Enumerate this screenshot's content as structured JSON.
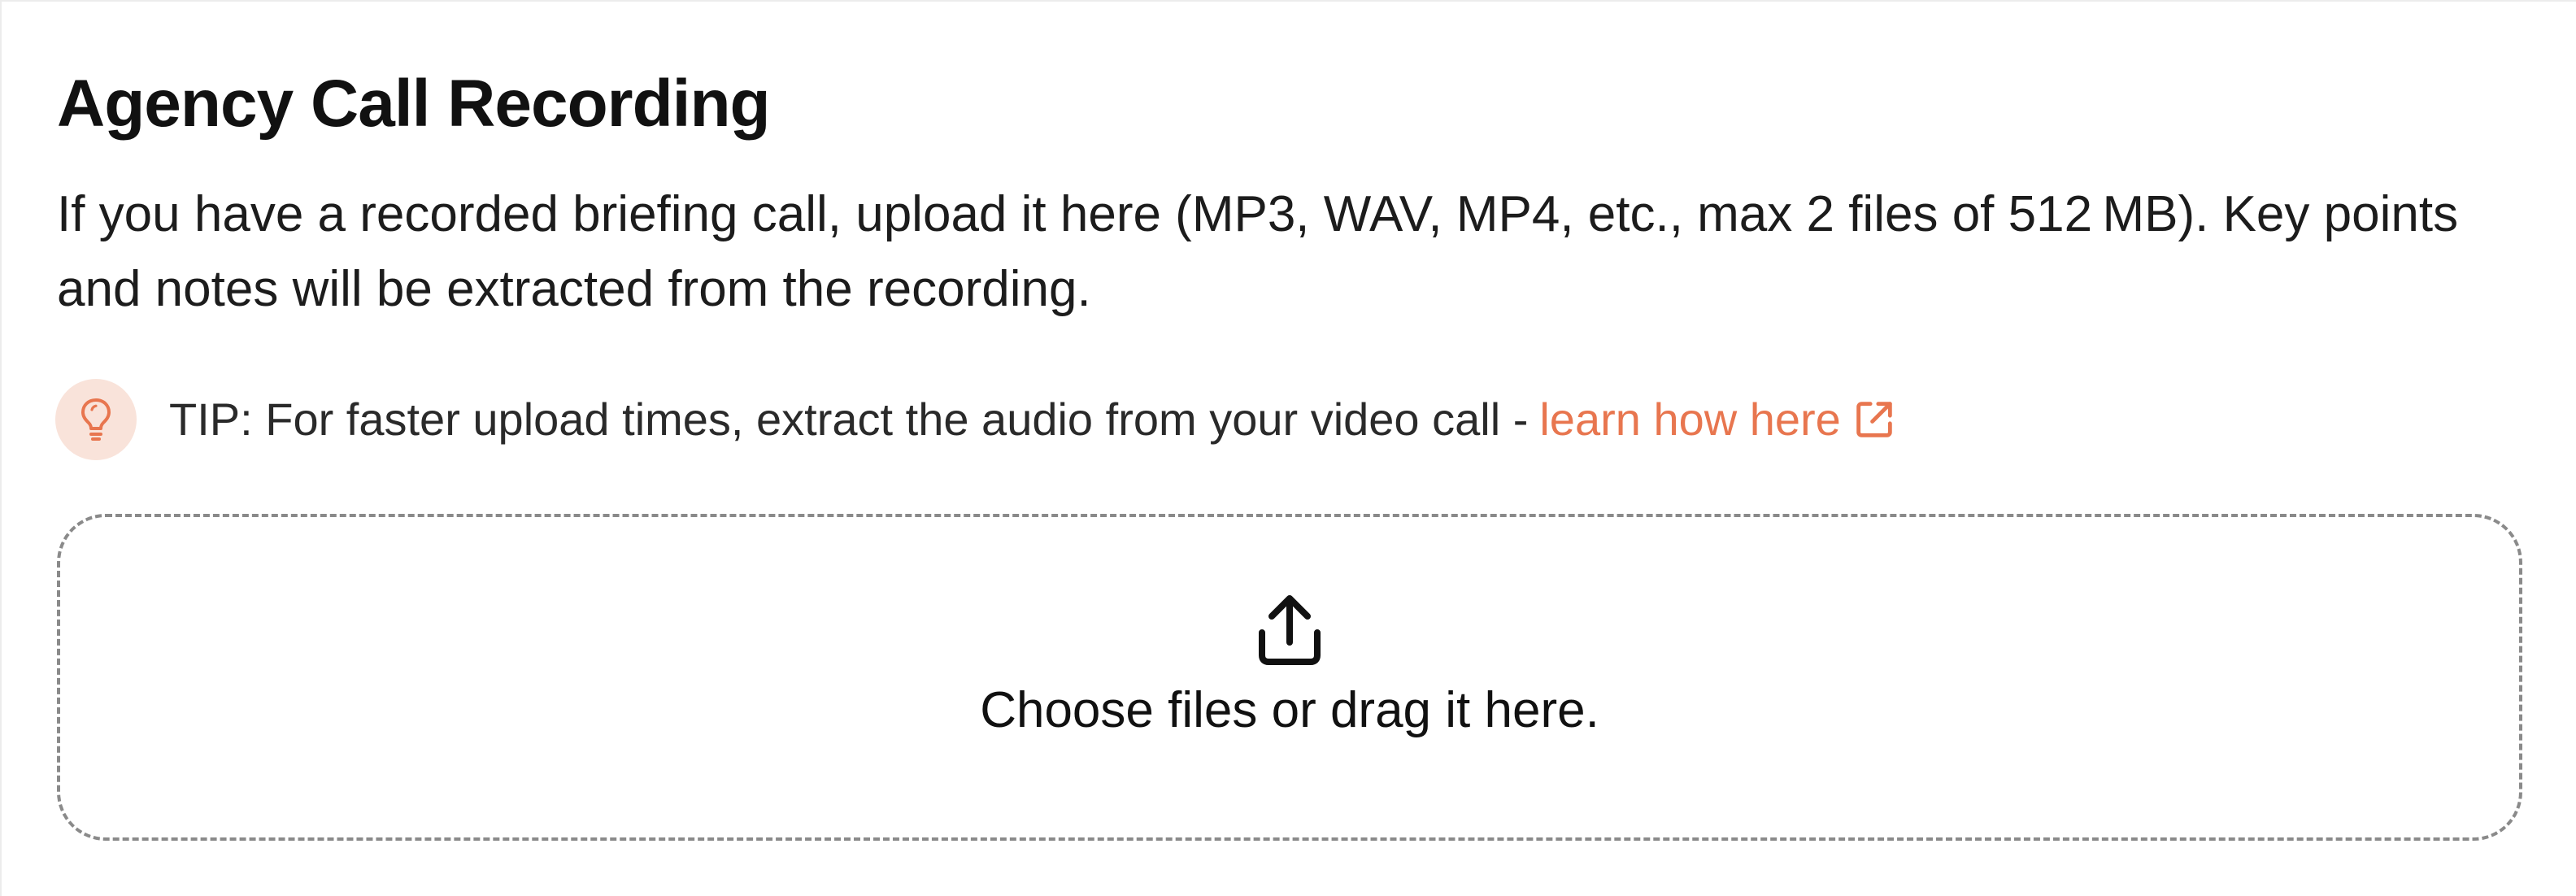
{
  "section": {
    "title": "Agency Call Recording",
    "description": "If you have a recorded briefing call, upload it here (MP3, WAV, MP4, etc., max 2 files of 512 MB). Key points and notes will be extracted from the recording."
  },
  "tip": {
    "icon": "lightbulb-icon",
    "text": "TIP: For faster upload times, extract the audio from your video call -",
    "link_label": "learn how here",
    "link_icon": "external-link-icon"
  },
  "upload": {
    "icon": "upload-icon",
    "label": "Choose files or drag it here."
  },
  "colors": {
    "accent": "#e8764f",
    "tip_icon_background": "#f9e3da",
    "dropzone_border": "#8a8a8a",
    "text": "#111111"
  }
}
